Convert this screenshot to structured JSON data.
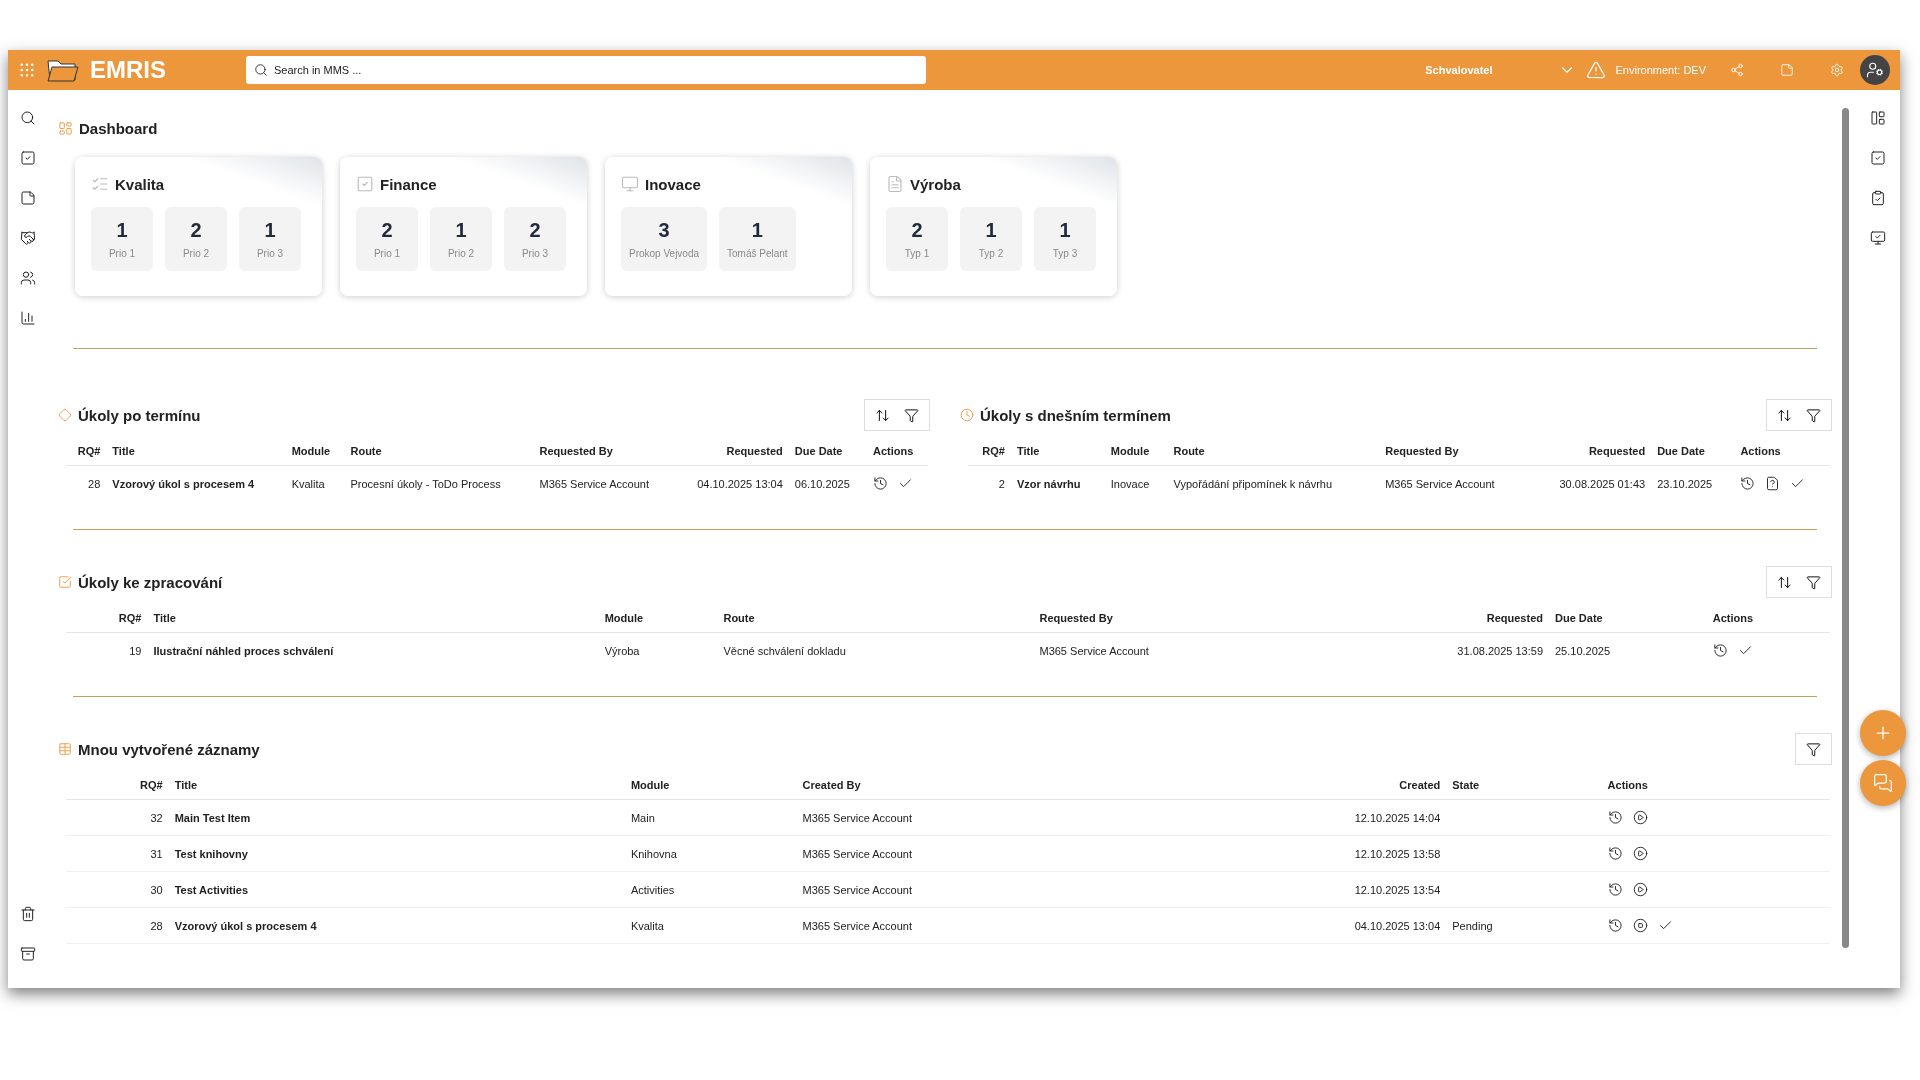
{
  "topbar": {
    "logo": "EMRIS",
    "search": {
      "placeholder": "Search in MMS ..."
    },
    "role": "Schvalovatel",
    "environment": "Environment: DEV"
  },
  "dashboard": {
    "title": "Dashboard",
    "cards": [
      {
        "title": "Kvalita",
        "tiles": [
          {
            "count": "1",
            "label": "Prio 1"
          },
          {
            "count": "2",
            "label": "Prio 2"
          },
          {
            "count": "1",
            "label": "Prio 3"
          }
        ]
      },
      {
        "title": "Finance",
        "tiles": [
          {
            "count": "2",
            "label": "Prio 1"
          },
          {
            "count": "1",
            "label": "Prio 2"
          },
          {
            "count": "2",
            "label": "Prio 3"
          }
        ]
      },
      {
        "title": "Inovace",
        "tiles": [
          {
            "count": "3",
            "label": "Prokop Vejvoda"
          },
          {
            "count": "1",
            "label": "Tomáš Pelant"
          }
        ]
      },
      {
        "title": "Výroba",
        "tiles": [
          {
            "count": "2",
            "label": "Typ 1"
          },
          {
            "count": "1",
            "label": "Typ 2"
          },
          {
            "count": "1",
            "label": "Typ 3"
          }
        ]
      }
    ]
  },
  "sections": [
    {
      "title": "Úkoly po termínu",
      "tools": [
        {
          "kind": "sort"
        },
        {
          "kind": "filter"
        }
      ],
      "columns": [
        "RQ#",
        "Title",
        "Module",
        "Route",
        "Requested By",
        "Requested",
        "Due Date",
        "Actions"
      ],
      "rows": [
        {
          "cells": [
            "28",
            "Vzorový úkol s procesem 4",
            "Kvalita",
            "Procesní úkoly - ToDo Process",
            "M365 Service Account",
            "04.10.2025 13:04",
            "06.10.2025"
          ],
          "actions": [
            {
              "kind": "history"
            },
            {
              "kind": "check"
            }
          ]
        }
      ]
    },
    {
      "title": "Úkoly s dnešním termínem",
      "tools": [
        {
          "kind": "sort"
        },
        {
          "kind": "filter"
        }
      ],
      "columns": [
        "RQ#",
        "Title",
        "Module",
        "Route",
        "Requested By",
        "Requested",
        "Due Date",
        "Actions"
      ],
      "rows": [
        {
          "cells": [
            "2",
            "Vzor návrhu",
            "Inovace",
            "Vypořádání připomínek k návrhu",
            "M365 Service Account",
            "30.08.2025 01:43",
            "23.10.2025"
          ],
          "actions": [
            {
              "kind": "history"
            },
            {
              "kind": "help"
            },
            {
              "kind": "check"
            }
          ]
        }
      ]
    },
    {
      "title": "Úkoly ke zpracování",
      "tools": [
        {
          "kind": "sort"
        },
        {
          "kind": "filter"
        }
      ],
      "columns": [
        "RQ#",
        "Title",
        "Module",
        "Route",
        "Requested By",
        "Requested",
        "Due Date",
        "Actions"
      ],
      "rows": [
        {
          "cells": [
            "19",
            "Ilustrační náhled proces schválení",
            "Výroba",
            "Věcné schválení dokladu",
            "M365 Service Account",
            "31.08.2025 13:59",
            "25.10.2025"
          ],
          "actions": [
            {
              "kind": "history"
            },
            {
              "kind": "check"
            }
          ]
        }
      ]
    },
    {
      "title": "Mnou vytvořené záznamy",
      "tools": [
        {
          "kind": "filter"
        }
      ],
      "columns": [
        "RQ#",
        "Title",
        "Module",
        "Created By",
        "Created",
        "State",
        "Actions"
      ],
      "rows": [
        {
          "cells": [
            "32",
            "Main Test Item",
            "Main",
            "M365 Service Account",
            "12.10.2025 14:04",
            ""
          ],
          "actions": [
            {
              "kind": "history"
            },
            {
              "kind": "play"
            }
          ]
        },
        {
          "cells": [
            "31",
            "Test knihovny",
            "Knihovna",
            "M365 Service Account",
            "12.10.2025 13:58",
            ""
          ],
          "actions": [
            {
              "kind": "history"
            },
            {
              "kind": "play"
            }
          ]
        },
        {
          "cells": [
            "30",
            "Test Activities",
            "Activities",
            "M365 Service Account",
            "12.10.2025 13:54",
            ""
          ],
          "actions": [
            {
              "kind": "history"
            },
            {
              "kind": "play"
            }
          ]
        },
        {
          "cells": [
            "28",
            "Vzorový úkol s procesem 4",
            "Kvalita",
            "M365 Service Account",
            "04.10.2025 13:04",
            "Pending"
          ],
          "actions": [
            {
              "kind": "history"
            },
            {
              "kind": "stop"
            },
            {
              "kind": "check"
            }
          ]
        }
      ]
    }
  ]
}
